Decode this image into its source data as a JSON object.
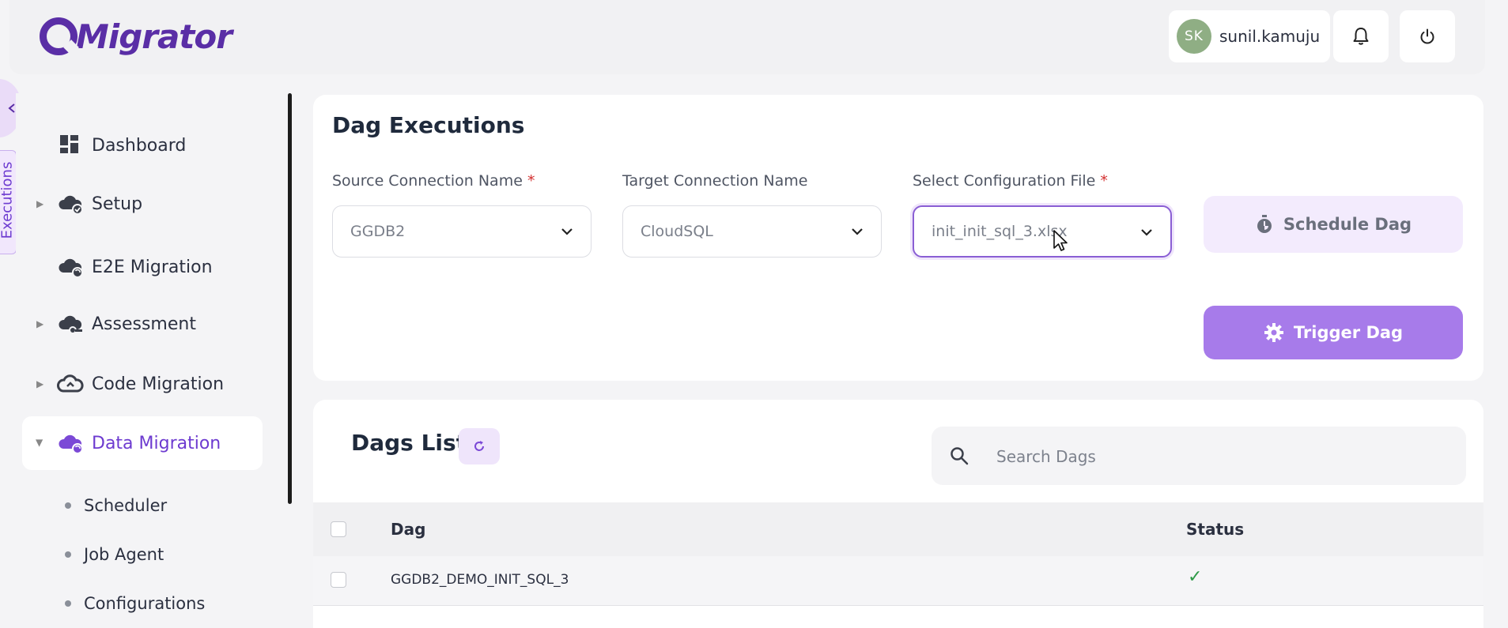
{
  "header": {
    "logo_text": "Migrator",
    "user": {
      "initials": "SK",
      "name": "sunil.kamuju"
    },
    "icons": [
      "bell-icon",
      "power-icon"
    ]
  },
  "side_tab": {
    "label": "Executions"
  },
  "sidebar": {
    "items": [
      {
        "label": "Dashboard",
        "icon": "dashboard-icon",
        "expandable": false
      },
      {
        "label": "Setup",
        "icon": "cloud-check-icon",
        "expandable": true
      },
      {
        "label": "E2E Migration",
        "icon": "cloud-sync-icon",
        "expandable": false
      },
      {
        "label": "Assessment",
        "icon": "cloud-key-icon",
        "expandable": true
      },
      {
        "label": "Code Migration",
        "icon": "cloud-code-icon",
        "expandable": true
      },
      {
        "label": "Data Migration",
        "icon": "cloud-data-icon",
        "expandable": true,
        "active": true
      }
    ],
    "sub_items": [
      "Scheduler",
      "Job Agent",
      "Configurations"
    ]
  },
  "dag_executions": {
    "title": "Dag Executions",
    "source": {
      "label": "Source Connection Name",
      "required": "*",
      "value": "GGDB2"
    },
    "target": {
      "label": "Target Connection Name",
      "value": "CloudSQL"
    },
    "config": {
      "label": "Select Configuration File",
      "required": "*",
      "value": "init_init_sql_3.xlsx"
    },
    "schedule_label": "Schedule Dag",
    "trigger_label": "Trigger Dag"
  },
  "dags_list": {
    "title": "Dags List",
    "search_placeholder": "Search Dags",
    "columns": {
      "dag": "Dag",
      "status": "Status"
    },
    "rows": [
      {
        "dag": "GGDB2_DEMO_INIT_SQL_3",
        "status": "✓"
      }
    ]
  },
  "colors": {
    "accent": "#6d3bd0",
    "button": "#a77bea",
    "success": "#2e9a47"
  }
}
